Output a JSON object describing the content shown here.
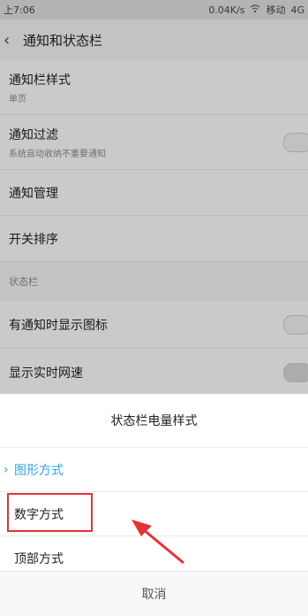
{
  "status_bar": {
    "time": "上7:06",
    "speed": "0.04K/s",
    "carrier": "移动",
    "network": "4G"
  },
  "header": {
    "back_icon": "chevron-left-icon",
    "title": "通知和状态栏"
  },
  "settings": {
    "notif_style": {
      "label": "通知栏样式",
      "value": "单页"
    },
    "notif_filter": {
      "label": "通知过滤",
      "sub": "系统自动收纳不重要通知"
    },
    "notif_manage": {
      "label": "通知管理"
    },
    "switch_order": {
      "label": "开关排序"
    },
    "section_label": "状态栏",
    "show_icon": {
      "label": "有通知时显示图标"
    },
    "net_speed": {
      "label": "显示实时网速"
    }
  },
  "sheet": {
    "title": "状态栏电量样式",
    "options": [
      "图形方式",
      "数字方式",
      "顶部方式"
    ],
    "selected": "图形方式",
    "cancel": "取消"
  },
  "colors": {
    "accent": "#2fa3df",
    "annotation": "#e3323a"
  }
}
